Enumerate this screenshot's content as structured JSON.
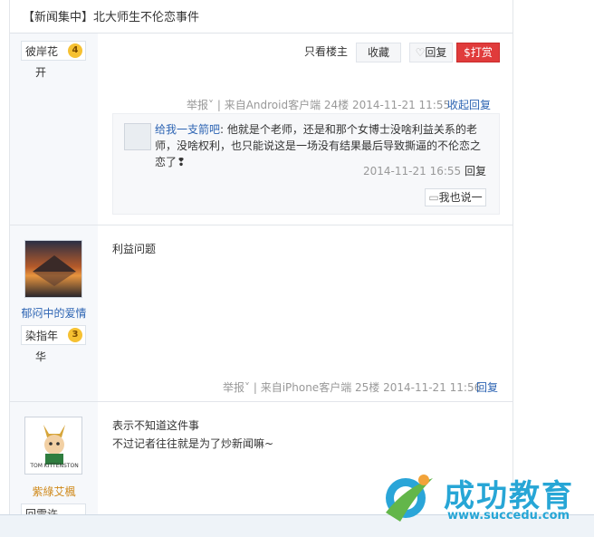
{
  "title": "【新闻集中】北大师生不伦恋事件",
  "post1": {
    "user_badge": "彼岸花",
    "level": "4",
    "sub": "开",
    "buttons": {
      "only_op": "只看楼主",
      "favorite": "收藏",
      "reply": "回复",
      "reward": "打赏"
    },
    "meta_report": "举报˅",
    "meta_from": " | 来自Android客户端 24楼 2014-11-21 11:55",
    "collapse_reply": "收起回复",
    "reply": {
      "author": "给我一支箭吧",
      "text": ": 他就是个老师，还是和那个女博士没啥利益关系的老师，没啥权利，也只能说这是一场没有结果最后导致撕逼的不伦恋之恋了❢",
      "time": "2014-11-21 16:55",
      "reply_label": "回复",
      "say_label": "我也说一"
    }
  },
  "post2": {
    "username": "郁闷中的爱情",
    "user_badge": "染指年",
    "level": "3",
    "sub": "华",
    "content": "利益问题",
    "meta_report": "举报˅",
    "meta_from": " | 来自iPhone客户端 25楼 2014-11-21 11:56",
    "reply_label": "回复"
  },
  "post3": {
    "username": "紫綠艾楓",
    "avatar_caption": "TOM KITTENSTON",
    "badge_partial": "回雷许",
    "content_line1": "表示不知道这件事",
    "content_line2": "不过记者往往就是为了炒新闻嘛~"
  },
  "watermark": {
    "cn": "成功教育",
    "url": "www.succedu.com"
  }
}
